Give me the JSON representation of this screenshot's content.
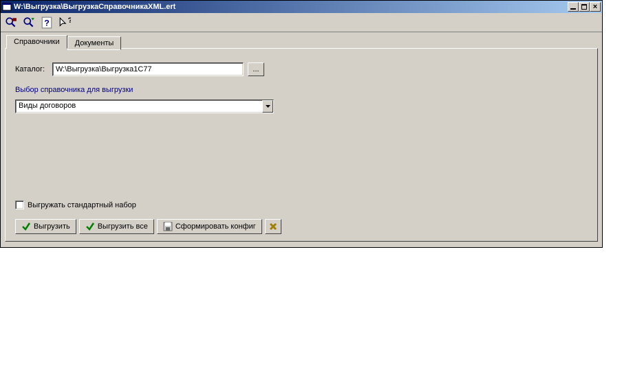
{
  "window": {
    "title": "W:\\Выгрузка\\ВыгрузкаСправочникаXML.ert"
  },
  "tabs": {
    "active": "Справочники",
    "inactive": "Документы"
  },
  "catalog": {
    "label": "Каталог:",
    "value": "W:\\Выгрузка\\Выгрузка1C77",
    "browse": "..."
  },
  "section": {
    "title": "Выбор справочника для выгрузки"
  },
  "combo": {
    "selected": "Виды договоров"
  },
  "checkbox": {
    "label": "Выгружать стандартный набор",
    "checked": false
  },
  "buttons": {
    "export": "Выгрузить",
    "export_all": "Выгрузить все",
    "make_config": "Сформировать конфиг"
  }
}
